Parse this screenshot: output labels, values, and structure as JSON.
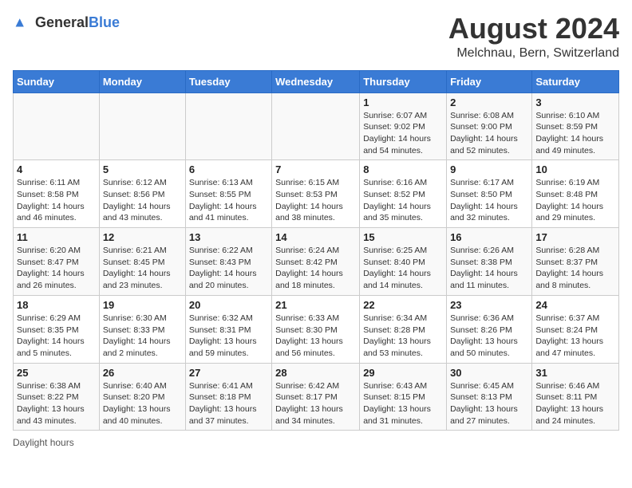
{
  "header": {
    "logo_general": "General",
    "logo_blue": "Blue",
    "title": "August 2024",
    "subtitle": "Melchnau, Bern, Switzerland"
  },
  "days_of_week": [
    "Sunday",
    "Monday",
    "Tuesday",
    "Wednesday",
    "Thursday",
    "Friday",
    "Saturday"
  ],
  "weeks": [
    [
      {
        "day": "",
        "sunrise": "",
        "sunset": "",
        "daylight": ""
      },
      {
        "day": "",
        "sunrise": "",
        "sunset": "",
        "daylight": ""
      },
      {
        "day": "",
        "sunrise": "",
        "sunset": "",
        "daylight": ""
      },
      {
        "day": "",
        "sunrise": "",
        "sunset": "",
        "daylight": ""
      },
      {
        "day": "1",
        "sunrise": "Sunrise: 6:07 AM",
        "sunset": "Sunset: 9:02 PM",
        "daylight": "Daylight: 14 hours and 54 minutes."
      },
      {
        "day": "2",
        "sunrise": "Sunrise: 6:08 AM",
        "sunset": "Sunset: 9:00 PM",
        "daylight": "Daylight: 14 hours and 52 minutes."
      },
      {
        "day": "3",
        "sunrise": "Sunrise: 6:10 AM",
        "sunset": "Sunset: 8:59 PM",
        "daylight": "Daylight: 14 hours and 49 minutes."
      }
    ],
    [
      {
        "day": "4",
        "sunrise": "Sunrise: 6:11 AM",
        "sunset": "Sunset: 8:58 PM",
        "daylight": "Daylight: 14 hours and 46 minutes."
      },
      {
        "day": "5",
        "sunrise": "Sunrise: 6:12 AM",
        "sunset": "Sunset: 8:56 PM",
        "daylight": "Daylight: 14 hours and 43 minutes."
      },
      {
        "day": "6",
        "sunrise": "Sunrise: 6:13 AM",
        "sunset": "Sunset: 8:55 PM",
        "daylight": "Daylight: 14 hours and 41 minutes."
      },
      {
        "day": "7",
        "sunrise": "Sunrise: 6:15 AM",
        "sunset": "Sunset: 8:53 PM",
        "daylight": "Daylight: 14 hours and 38 minutes."
      },
      {
        "day": "8",
        "sunrise": "Sunrise: 6:16 AM",
        "sunset": "Sunset: 8:52 PM",
        "daylight": "Daylight: 14 hours and 35 minutes."
      },
      {
        "day": "9",
        "sunrise": "Sunrise: 6:17 AM",
        "sunset": "Sunset: 8:50 PM",
        "daylight": "Daylight: 14 hours and 32 minutes."
      },
      {
        "day": "10",
        "sunrise": "Sunrise: 6:19 AM",
        "sunset": "Sunset: 8:48 PM",
        "daylight": "Daylight: 14 hours and 29 minutes."
      }
    ],
    [
      {
        "day": "11",
        "sunrise": "Sunrise: 6:20 AM",
        "sunset": "Sunset: 8:47 PM",
        "daylight": "Daylight: 14 hours and 26 minutes."
      },
      {
        "day": "12",
        "sunrise": "Sunrise: 6:21 AM",
        "sunset": "Sunset: 8:45 PM",
        "daylight": "Daylight: 14 hours and 23 minutes."
      },
      {
        "day": "13",
        "sunrise": "Sunrise: 6:22 AM",
        "sunset": "Sunset: 8:43 PM",
        "daylight": "Daylight: 14 hours and 20 minutes."
      },
      {
        "day": "14",
        "sunrise": "Sunrise: 6:24 AM",
        "sunset": "Sunset: 8:42 PM",
        "daylight": "Daylight: 14 hours and 18 minutes."
      },
      {
        "day": "15",
        "sunrise": "Sunrise: 6:25 AM",
        "sunset": "Sunset: 8:40 PM",
        "daylight": "Daylight: 14 hours and 14 minutes."
      },
      {
        "day": "16",
        "sunrise": "Sunrise: 6:26 AM",
        "sunset": "Sunset: 8:38 PM",
        "daylight": "Daylight: 14 hours and 11 minutes."
      },
      {
        "day": "17",
        "sunrise": "Sunrise: 6:28 AM",
        "sunset": "Sunset: 8:37 PM",
        "daylight": "Daylight: 14 hours and 8 minutes."
      }
    ],
    [
      {
        "day": "18",
        "sunrise": "Sunrise: 6:29 AM",
        "sunset": "Sunset: 8:35 PM",
        "daylight": "Daylight: 14 hours and 5 minutes."
      },
      {
        "day": "19",
        "sunrise": "Sunrise: 6:30 AM",
        "sunset": "Sunset: 8:33 PM",
        "daylight": "Daylight: 14 hours and 2 minutes."
      },
      {
        "day": "20",
        "sunrise": "Sunrise: 6:32 AM",
        "sunset": "Sunset: 8:31 PM",
        "daylight": "Daylight: 13 hours and 59 minutes."
      },
      {
        "day": "21",
        "sunrise": "Sunrise: 6:33 AM",
        "sunset": "Sunset: 8:30 PM",
        "daylight": "Daylight: 13 hours and 56 minutes."
      },
      {
        "day": "22",
        "sunrise": "Sunrise: 6:34 AM",
        "sunset": "Sunset: 8:28 PM",
        "daylight": "Daylight: 13 hours and 53 minutes."
      },
      {
        "day": "23",
        "sunrise": "Sunrise: 6:36 AM",
        "sunset": "Sunset: 8:26 PM",
        "daylight": "Daylight: 13 hours and 50 minutes."
      },
      {
        "day": "24",
        "sunrise": "Sunrise: 6:37 AM",
        "sunset": "Sunset: 8:24 PM",
        "daylight": "Daylight: 13 hours and 47 minutes."
      }
    ],
    [
      {
        "day": "25",
        "sunrise": "Sunrise: 6:38 AM",
        "sunset": "Sunset: 8:22 PM",
        "daylight": "Daylight: 13 hours and 43 minutes."
      },
      {
        "day": "26",
        "sunrise": "Sunrise: 6:40 AM",
        "sunset": "Sunset: 8:20 PM",
        "daylight": "Daylight: 13 hours and 40 minutes."
      },
      {
        "day": "27",
        "sunrise": "Sunrise: 6:41 AM",
        "sunset": "Sunset: 8:18 PM",
        "daylight": "Daylight: 13 hours and 37 minutes."
      },
      {
        "day": "28",
        "sunrise": "Sunrise: 6:42 AM",
        "sunset": "Sunset: 8:17 PM",
        "daylight": "Daylight: 13 hours and 34 minutes."
      },
      {
        "day": "29",
        "sunrise": "Sunrise: 6:43 AM",
        "sunset": "Sunset: 8:15 PM",
        "daylight": "Daylight: 13 hours and 31 minutes."
      },
      {
        "day": "30",
        "sunrise": "Sunrise: 6:45 AM",
        "sunset": "Sunset: 8:13 PM",
        "daylight": "Daylight: 13 hours and 27 minutes."
      },
      {
        "day": "31",
        "sunrise": "Sunrise: 6:46 AM",
        "sunset": "Sunset: 8:11 PM",
        "daylight": "Daylight: 13 hours and 24 minutes."
      }
    ]
  ],
  "footer": {
    "note": "Daylight hours"
  }
}
